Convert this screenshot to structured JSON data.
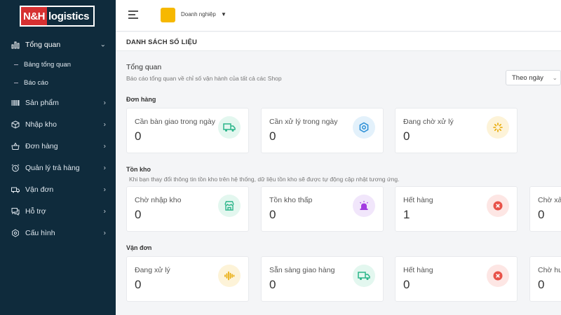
{
  "logo": {
    "part1": "N&H",
    "part2": "logistics"
  },
  "sidebar": {
    "items": [
      {
        "label": "Tổng quan",
        "icon": "chart-bar-icon",
        "active": true
      },
      {
        "label": "Sản phẩm",
        "icon": "barcode-icon"
      },
      {
        "label": "Nhập kho",
        "icon": "box-icon"
      },
      {
        "label": "Đơn hàng",
        "icon": "basket-icon"
      },
      {
        "label": "Quản lý trả hàng",
        "icon": "alarm-clock-icon"
      },
      {
        "label": "Vận đơn",
        "icon": "truck-icon"
      },
      {
        "label": "Hỗ trợ",
        "icon": "chat-icon"
      },
      {
        "label": "Cấu hình",
        "icon": "gear-icon"
      }
    ],
    "subitems": [
      {
        "label": "Bảng tổng quan"
      },
      {
        "label": "Báo cáo"
      }
    ]
  },
  "topbar": {
    "org_name": "Doanh nghiệp",
    "org_color": "#f6b800"
  },
  "main": {
    "title": "DANH SÁCH SỐ LIỆU"
  },
  "overview": {
    "title": "Tổng quan",
    "desc": "Báo cáo tổng quan về chỉ số vận hành của tất cả các Shop",
    "period": "Theo ngày"
  },
  "orders": {
    "label": "Đơn hàng",
    "cards": [
      {
        "label": "Cần bàn giao trong ngày",
        "value": "0",
        "icon": "truck-icon",
        "color": "#e3f7ef"
      },
      {
        "label": "Cần xử lý trong ngày",
        "value": "0",
        "icon": "gear-icon",
        "color": "#e3f1fb"
      },
      {
        "label": "Đang chờ xử lý",
        "value": "0",
        "icon": "spinner-icon",
        "color": "#fdf3d8"
      }
    ]
  },
  "inventory": {
    "label": "Tồn kho",
    "desc": "Khi bạn thay đổi thông tin tồn kho trên hệ thống, dữ liệu tồn kho sẽ được tự động cập nhật tương ứng.",
    "cards": [
      {
        "label": "Chờ nhập kho",
        "value": "0",
        "icon": "store-icon",
        "color": "#e3f7ef"
      },
      {
        "label": "Tồn kho thấp",
        "value": "0",
        "icon": "siren-icon",
        "color": "#f1e6fb"
      },
      {
        "label": "Hết hàng",
        "value": "1",
        "icon": "close-circle-icon",
        "color": "#fde6e4"
      },
      {
        "label": "Chờ xả",
        "value": "0"
      }
    ]
  },
  "shipping": {
    "label": "Vận đơn",
    "cards": [
      {
        "label": "Đang xử lý",
        "value": "0",
        "icon": "soundwave-icon",
        "color": "#fdf3d8"
      },
      {
        "label": "Sẵn sàng giao hàng",
        "value": "0",
        "icon": "truck-icon",
        "color": "#e3f7ef"
      },
      {
        "label": "Hết hàng",
        "value": "0",
        "icon": "close-circle-icon",
        "color": "#fde6e4"
      },
      {
        "label": "Chờ hu",
        "value": "0"
      }
    ]
  }
}
